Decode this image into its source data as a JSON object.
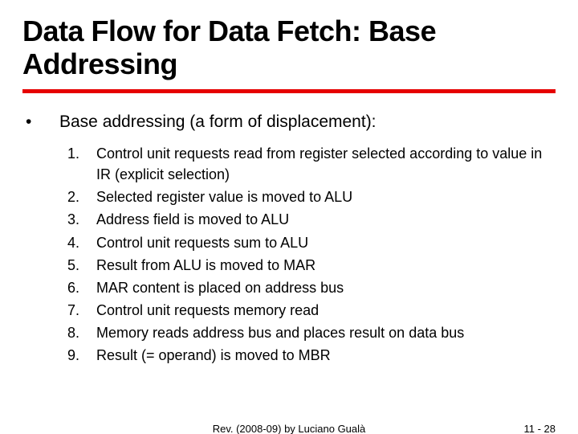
{
  "title": "Data Flow for Data Fetch: Base Addressing",
  "bullet": {
    "marker": "•",
    "text": "Base addressing (a form of displacement):"
  },
  "steps": [
    {
      "n": "1.",
      "t": "Control unit requests read from register selected according to value in IR (explicit selection)"
    },
    {
      "n": "2.",
      "t": "Selected register value is moved to ALU"
    },
    {
      "n": "3.",
      "t": "Address field is moved to ALU"
    },
    {
      "n": "4.",
      "t": "Control unit requests sum to ALU"
    },
    {
      "n": "5.",
      "t": "Result from ALU is moved to MAR"
    },
    {
      "n": "6.",
      "t": "MAR content is placed on address bus"
    },
    {
      "n": "7.",
      "t": "Control unit requests memory read"
    },
    {
      "n": "8.",
      "t": "Memory reads address bus and places result on data bus"
    },
    {
      "n": "9.",
      "t": "Result (= operand) is moved to MBR"
    }
  ],
  "footer": {
    "center": "Rev. (2008-09) by Luciano Gualà",
    "right": "11 -  28"
  }
}
